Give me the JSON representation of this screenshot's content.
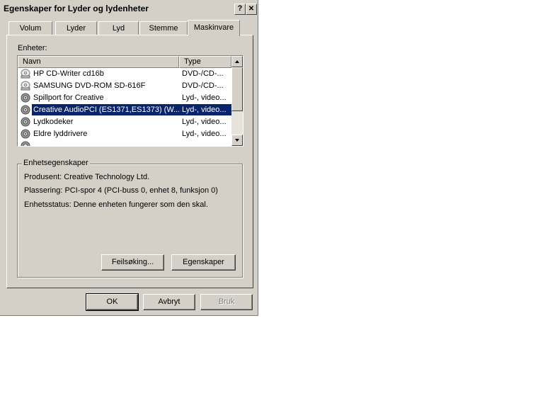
{
  "window": {
    "title": "Egenskaper for Lyder og lydenheter",
    "help_glyph": "?",
    "close_glyph": "✕"
  },
  "tabs": [
    {
      "label": "Volum"
    },
    {
      "label": "Lyder"
    },
    {
      "label": "Lyd"
    },
    {
      "label": "Stemme"
    },
    {
      "label": "Maskinvare",
      "active": true
    }
  ],
  "devices": {
    "label": "Enheter:",
    "columns": {
      "name": "Navn",
      "type": "Type"
    },
    "rows": [
      {
        "name": "HP CD-Writer cd16b",
        "type": "DVD-/CD-...",
        "icon": "cd-drive-icon"
      },
      {
        "name": "SAMSUNG DVD-ROM SD-616F",
        "type": "DVD-/CD-...",
        "icon": "cd-drive-icon"
      },
      {
        "name": "Spillport for Creative",
        "type": "Lyd-, video...",
        "icon": "sound-device-icon"
      },
      {
        "name": "Creative AudioPCI (ES1371,ES1373) (W...",
        "type": "Lyd-, video...",
        "icon": "sound-device-icon",
        "selected": true
      },
      {
        "name": "Lydkodeker",
        "type": "Lyd-, video...",
        "icon": "sound-device-icon"
      },
      {
        "name": "Eldre lyddrivere",
        "type": "Lyd-, video...",
        "icon": "sound-device-icon"
      }
    ]
  },
  "properties": {
    "title": "Enhetsegenskaper",
    "manufacturer": "Produsent: Creative Technology Ltd.",
    "location": "Plassering: PCI-spor 4 (PCI-buss 0, enhet 8, funksjon 0)",
    "status": "Enhetsstatus: Denne enheten fungerer som den skal.",
    "troubleshoot_label": "Feilsøking...",
    "properties_label": "Egenskaper"
  },
  "footer": {
    "ok_label": "OK",
    "cancel_label": "Avbryt",
    "apply_label": "Bruk"
  },
  "colors": {
    "face": "#d4d0c8",
    "selection": "#0a246a"
  }
}
